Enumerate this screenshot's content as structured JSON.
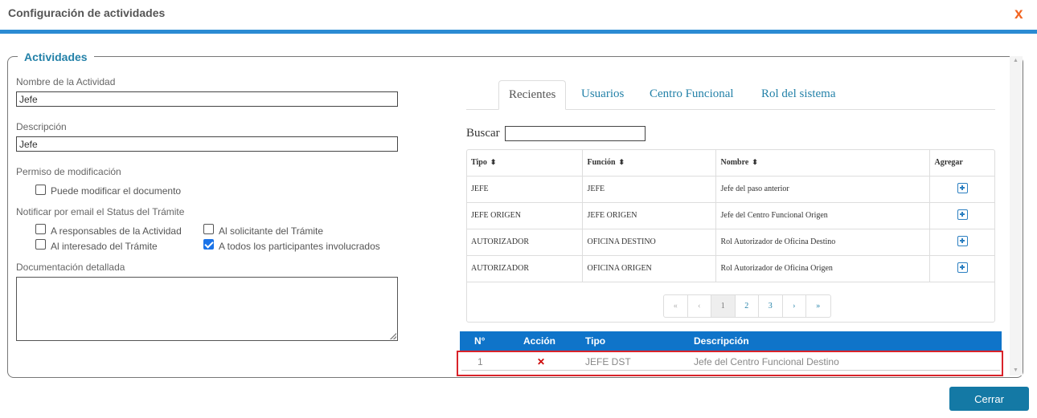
{
  "dialog": {
    "title": "Configuración de actividades",
    "close_glyph": "x"
  },
  "fieldset": {
    "legend": "Actividades"
  },
  "form": {
    "name_label": "Nombre de la Actividad",
    "name_value": "Jefe",
    "description_label": "Descripción",
    "description_value": "Jefe",
    "permission_label": "Permiso de modificación",
    "can_modify_label": "Puede modificar el documento",
    "can_modify_checked": false,
    "notify_label": "Notificar por email el Status del Trámite",
    "notify_options": [
      {
        "label": "A responsables de la Actividad",
        "checked": false
      },
      {
        "label": "Al solicitante del Trámite",
        "checked": false
      },
      {
        "label": "Al interesado del Trámite",
        "checked": false
      },
      {
        "label": "A todos los participantes involucrados",
        "checked": true
      }
    ],
    "docs_label": "Documentación detallada",
    "docs_value": ""
  },
  "tabs": [
    {
      "label": "Recientes",
      "active": true
    },
    {
      "label": "Usuarios",
      "active": false
    },
    {
      "label": "Centro Funcional",
      "active": false
    },
    {
      "label": "Rol del sistema",
      "active": false
    }
  ],
  "search": {
    "label": "Buscar",
    "value": ""
  },
  "table": {
    "columns": [
      "Tipo",
      "Función",
      "Nombre",
      "Agregar"
    ],
    "sort_glyph": "⬍",
    "rows": [
      {
        "tipo": "JEFE",
        "funcion": "JEFE",
        "nombre": "Jefe del paso anterior"
      },
      {
        "tipo": "JEFE ORIGEN",
        "funcion": "JEFE ORIGEN",
        "nombre": "Jefe del Centro Funcional Origen"
      },
      {
        "tipo": "AUTORIZADOR",
        "funcion": "OFICINA DESTINO",
        "nombre": "Rol Autorizador de Oficina Destino"
      },
      {
        "tipo": "AUTORIZADOR",
        "funcion": "OFICINA ORIGEN",
        "nombre": "Rol Autorizador de Oficina Origen"
      }
    ]
  },
  "pagination": {
    "first": "«",
    "prev": "‹",
    "pages": [
      "1",
      "2",
      "3"
    ],
    "current": "1",
    "next": "›",
    "last": "»"
  },
  "selected": {
    "columns": [
      "N°",
      "Acción",
      "Tipo",
      "Descripción"
    ],
    "rows": [
      {
        "num": "1",
        "action": "✕",
        "tipo": "JEFE DST",
        "descripcion": "Jefe del Centro Funcional Destino"
      }
    ]
  },
  "footer": {
    "close_button": "Cerrar"
  },
  "colors": {
    "accent_blue": "#2b8bd3",
    "header_blue": "#0f74c9",
    "button_teal": "#1479a5",
    "close_orange": "#f26522",
    "highlight_red": "#d9232a",
    "link_blue": "#2381a8"
  }
}
